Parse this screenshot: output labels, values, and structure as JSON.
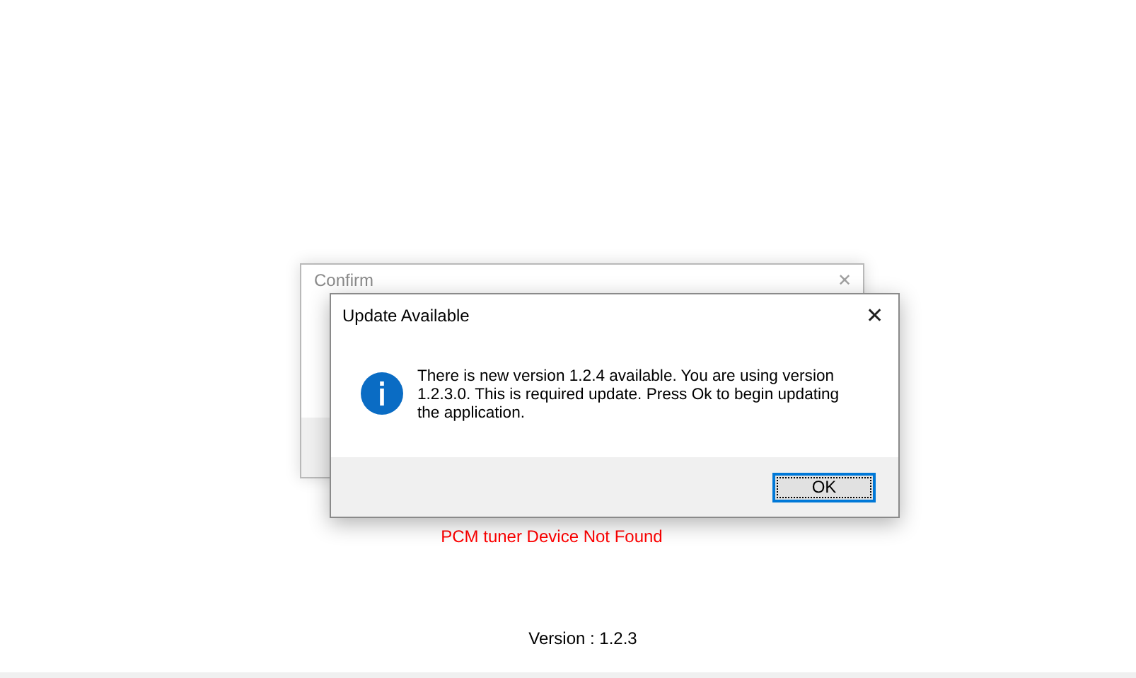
{
  "background_dialog": {
    "title": "Confirm",
    "close": "✕"
  },
  "dialog": {
    "title": "Update Available",
    "close": "✕",
    "message": "There is new version 1.2.4 available. You are using version 1.2.3.0. This is required update. Press Ok to begin updating the application.",
    "buttons": [
      {
        "label": "OK",
        "selected": true
      }
    ]
  },
  "status": {
    "error": "PCM tuner Device Not Found",
    "version": "Version : 1.2.3"
  }
}
